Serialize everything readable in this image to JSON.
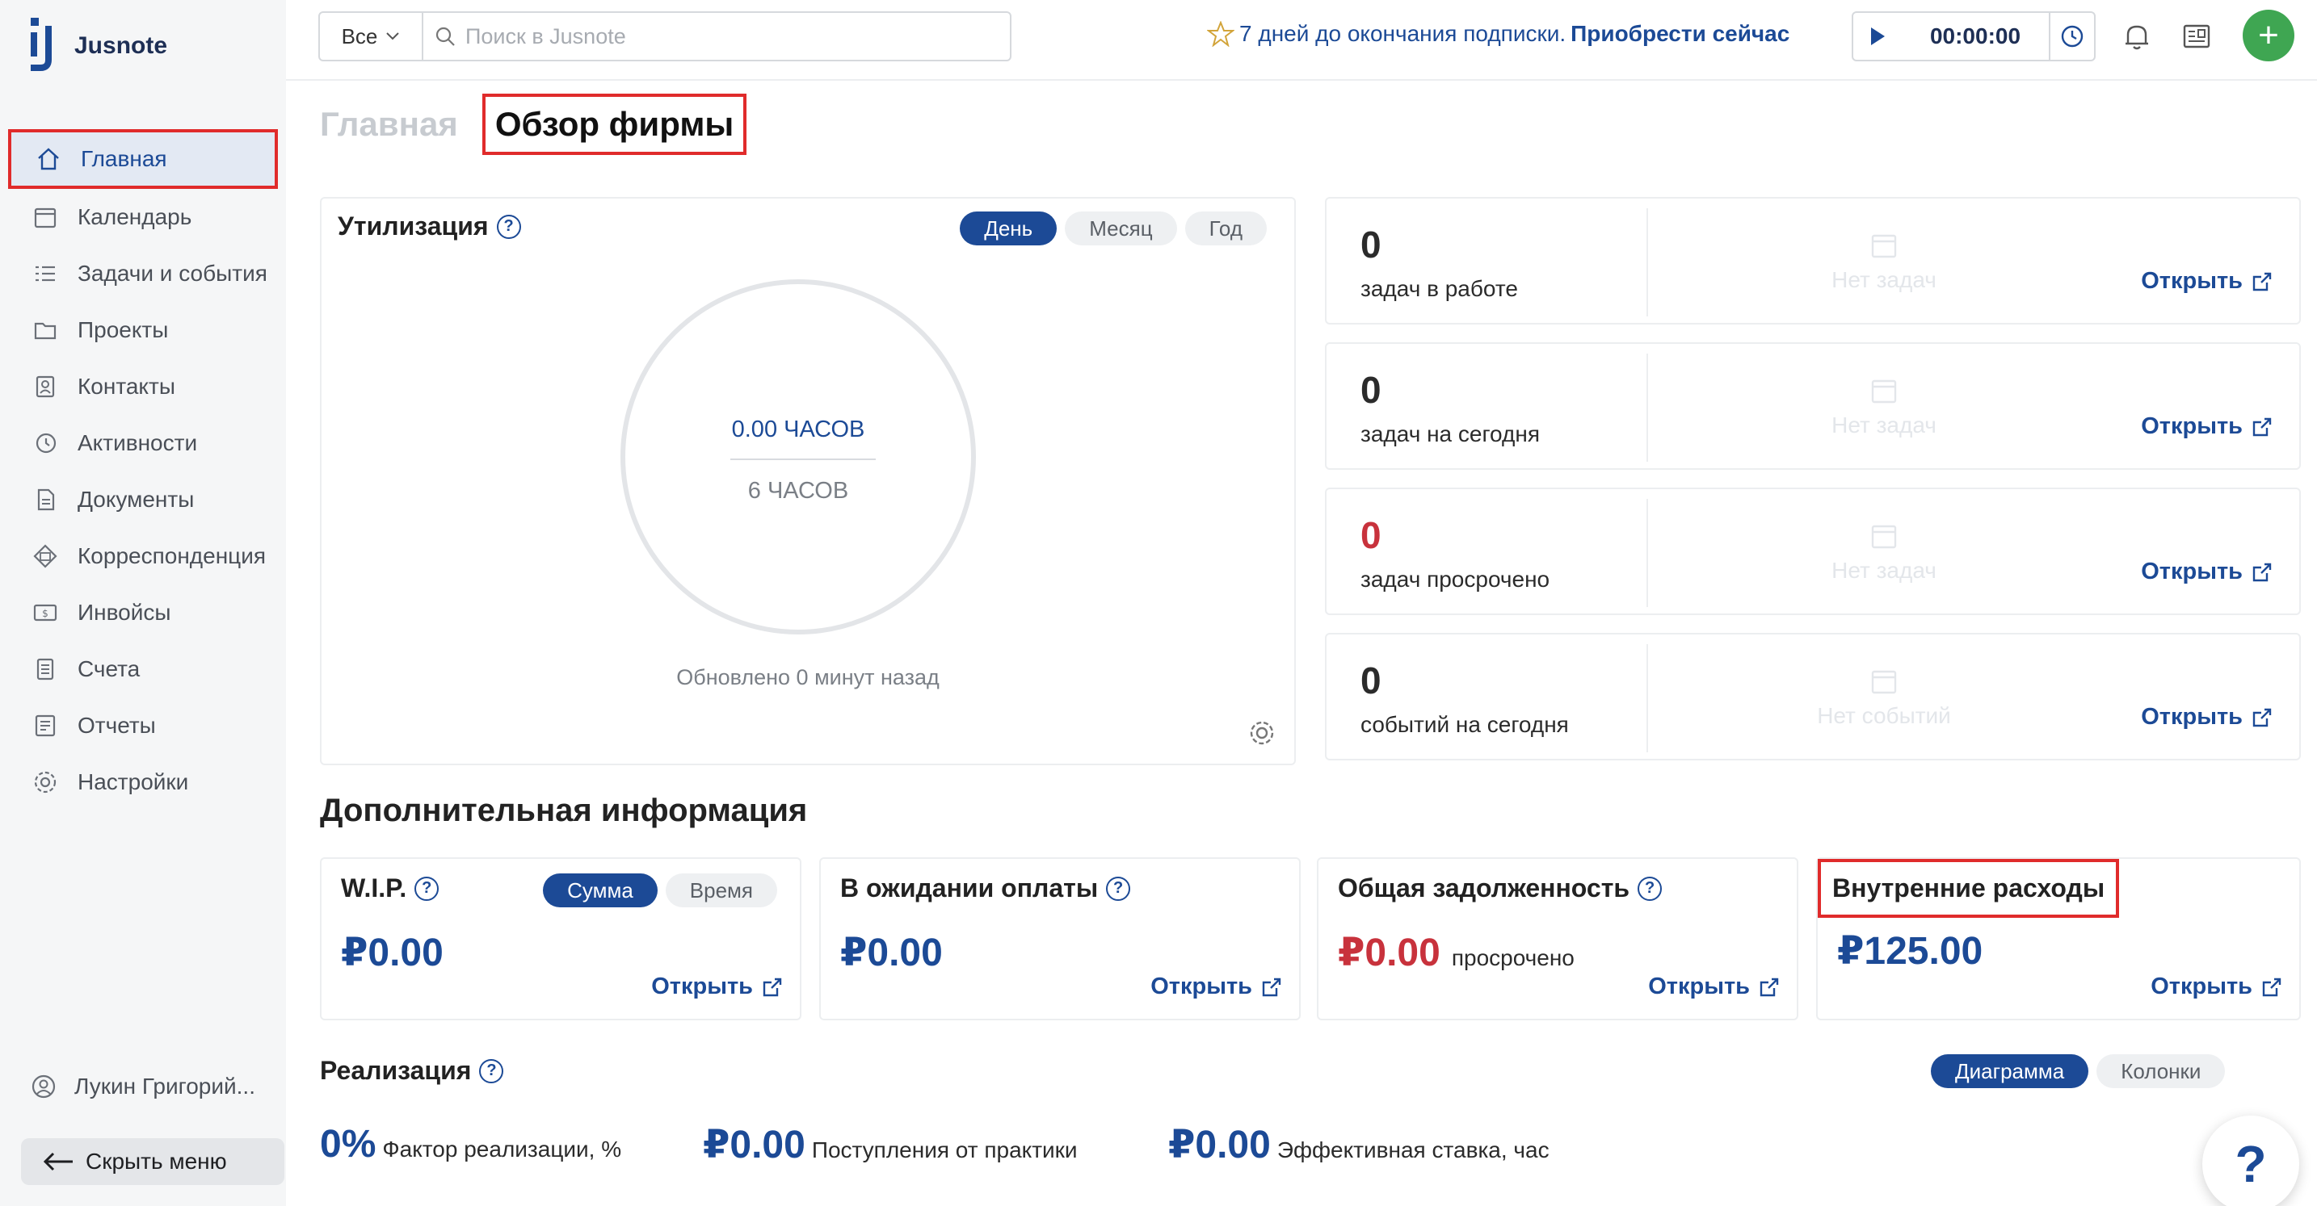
{
  "app": {
    "name": "Jusnote"
  },
  "sidebar": {
    "items": [
      {
        "label": "Главная",
        "icon": "home-icon"
      },
      {
        "label": "Календарь",
        "icon": "calendar-icon"
      },
      {
        "label": "Задачи и события",
        "icon": "tasks-icon"
      },
      {
        "label": "Проекты",
        "icon": "folder-icon"
      },
      {
        "label": "Контакты",
        "icon": "contacts-icon"
      },
      {
        "label": "Активности",
        "icon": "history-icon"
      },
      {
        "label": "Документы",
        "icon": "documents-icon"
      },
      {
        "label": "Корреспонденция",
        "icon": "mail-icon"
      },
      {
        "label": "Инвойсы",
        "icon": "invoice-icon"
      },
      {
        "label": "Счета",
        "icon": "accounts-icon"
      },
      {
        "label": "Отчеты",
        "icon": "reports-icon"
      },
      {
        "label": "Настройки",
        "icon": "gear-icon"
      }
    ],
    "user": "Лукин Григорий...",
    "hide_menu": "Скрыть меню"
  },
  "topbar": {
    "scope": "Все",
    "search_placeholder": "Поиск в Jusnote",
    "subscription_text": "7 дней до окончания подписки.",
    "subscription_link": "Приобрести сейчас",
    "timer": "00:00:00"
  },
  "tabs": {
    "home": "Главная",
    "overview": "Обзор фирмы"
  },
  "utilization": {
    "title": "Утилизация",
    "periods": [
      "День",
      "Месяц",
      "Год"
    ],
    "value": "0.00 ЧАСОВ",
    "target": "6 ЧАСОВ",
    "updated": "Обновлено 0 минут назад",
    "fraction": 0
  },
  "stats": [
    {
      "num": "0",
      "label": "задач в работе",
      "empty": "Нет задач",
      "open": "Открыть",
      "color": "#1c4a96"
    },
    {
      "num": "0",
      "label": "задач на сегодня",
      "empty": "Нет задач",
      "open": "Открыть",
      "color": "#1c4a96"
    },
    {
      "num": "0",
      "label": "задач просрочено",
      "empty": "Нет задач",
      "open": "Открыть",
      "color": "#c8323c"
    },
    {
      "num": "0",
      "label": "событий на сегодня",
      "empty": "Нет событий",
      "open": "Открыть",
      "color": "#1c4a96"
    }
  ],
  "additional": {
    "title": "Дополнительная информация",
    "wip": {
      "title": "W.I.P.",
      "toggle": [
        "Сумма",
        "Время"
      ],
      "amount": "₽0.00",
      "open": "Открыть"
    },
    "pending": {
      "title": "В ожидании оплаты",
      "amount": "₽0.00",
      "open": "Открыть"
    },
    "debt": {
      "title": "Общая задолженность",
      "amount": "₽0.00",
      "suffix": "просрочено",
      "open": "Открыть"
    },
    "internal": {
      "title": "Внутренние расходы",
      "amount": "₽125.00",
      "open": "Открыть"
    }
  },
  "realization": {
    "title": "Реализация",
    "views": [
      "Диаграмма",
      "Колонки"
    ],
    "metrics": [
      {
        "value": "0%",
        "label": "Фактор реализации, %"
      },
      {
        "value": "₽0.00",
        "label": "Поступления от практики"
      },
      {
        "value": "₽0.00",
        "label": "Эффективная ставка, час"
      }
    ]
  },
  "help": "?"
}
